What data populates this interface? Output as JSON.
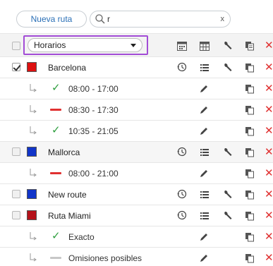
{
  "toolbar": {
    "new_route_label": "Nueva ruta",
    "search_value": "r",
    "search_icon": "search-icon",
    "clear_icon": "close-icon",
    "clear_glyph": "x"
  },
  "header": {
    "dropdown_selected": "Horarios",
    "dropdown_options_visible": [
      "Horarios"
    ],
    "column_icons": [
      "calendar-icon",
      "table-grid-icon",
      "wrench-icon",
      "copy-icon",
      "close-icon"
    ]
  },
  "colors": {
    "accent": "#2a6fb6",
    "highlight_border": "#a24cd6",
    "status_ok": "#2e9e3e",
    "status_error": "#e03131",
    "status_neutral": "#c7c7c7",
    "delete": "#e03131"
  },
  "routes": [
    {
      "name": "Barcelona",
      "checked": true,
      "color": "#dd1111",
      "schedules": [
        {
          "status": "ok",
          "text": "08:00 - 17:00"
        },
        {
          "status": "error",
          "text": "08:30 - 17:30"
        },
        {
          "status": "ok",
          "text": "10:35 - 21:05"
        }
      ]
    },
    {
      "name": "Mallorca",
      "checked": false,
      "color": "#1135c9",
      "schedules": [
        {
          "status": "error",
          "text": "08:00 - 21:00"
        }
      ]
    },
    {
      "name": "New route",
      "checked": false,
      "color": "#1135c9",
      "schedules": []
    },
    {
      "name": "Ruta Miami",
      "checked": false,
      "color": "#b5121b",
      "schedules": [
        {
          "status": "ok",
          "text": "Exacto"
        },
        {
          "status": "neutral",
          "text": "Omisiones posibles"
        }
      ]
    }
  ],
  "glyphs": {
    "check": "✓",
    "delete": "✕",
    "menu": "☰"
  }
}
